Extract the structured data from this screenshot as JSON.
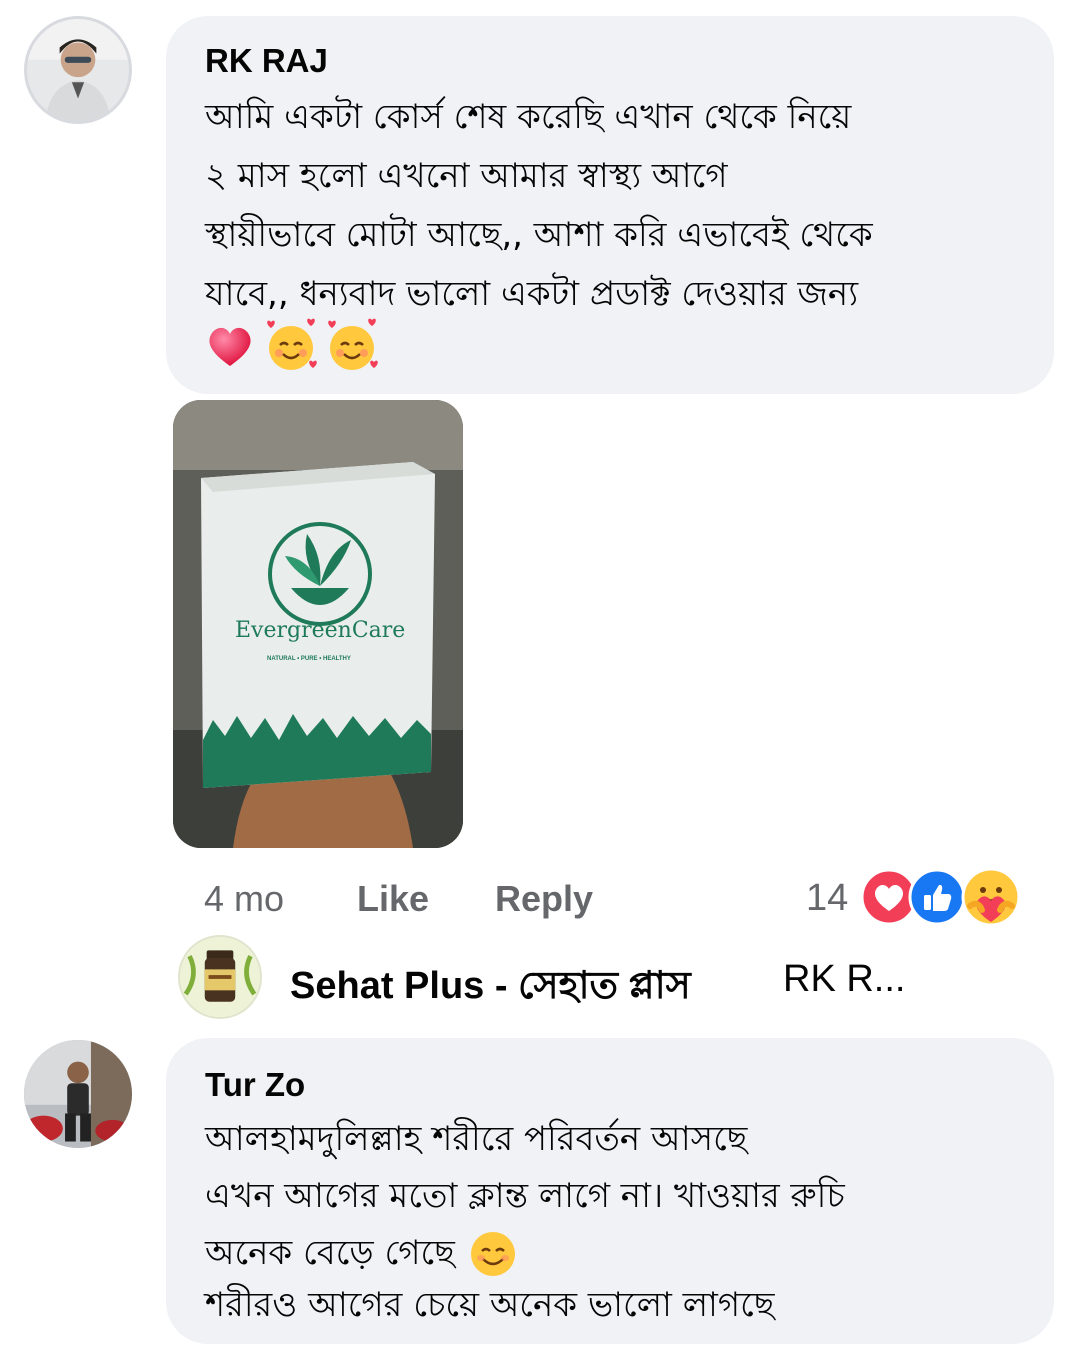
{
  "comment1": {
    "author": "RK RAJ",
    "text": "আমি একটা  কোর্স শেষ করেছি এখান থেকে নিয়ে\n২ মাস  হলো এখনো আমার স্বাস্থ্য আগে\nস্থায়ীভাবে মোটা আছে,, আশা করি এভাবেই থেকে\nযাবে,, ধন্যবাদ ভালো একটা প্রডাক্ট দেওয়ার জন্য",
    "emojis": [
      "heart-emoji",
      "smiling-face-with-hearts-emoji",
      "smiling-face-with-hearts-emoji"
    ],
    "photo": {
      "brand": "EvergreenCare",
      "tagline": "NATURAL • PURE • HEALTHY"
    },
    "time": "4 mo",
    "like_label": "Like",
    "reply_label": "Reply",
    "reaction_count": "14",
    "reaction_icons": [
      "love-reaction-icon",
      "like-reaction-icon",
      "care-reaction-icon"
    ]
  },
  "reply": {
    "author": "Sehat Plus - সেহাত প্লাস",
    "preview": "RK R..."
  },
  "comment2": {
    "author": "Tur Zo",
    "text_line1": "আলহামদুলিল্লাহ শরীরে পরিবর্তন আসছে",
    "text_line2": "এখন আগের মতো ক্লান্ত লাগে না। খাওয়ার রুচি",
    "text_line3": "অনেক বেড়ে গেছে",
    "text_line4": "শরীরও আগের চেয়ে অনেক ভালো লাগছে"
  },
  "colors": {
    "bubble": "#f0f2f5",
    "meta_text": "#65676b",
    "brand_green": "#1f7a5a",
    "like_blue": "#1877f2",
    "love_red": "#f33e58"
  }
}
